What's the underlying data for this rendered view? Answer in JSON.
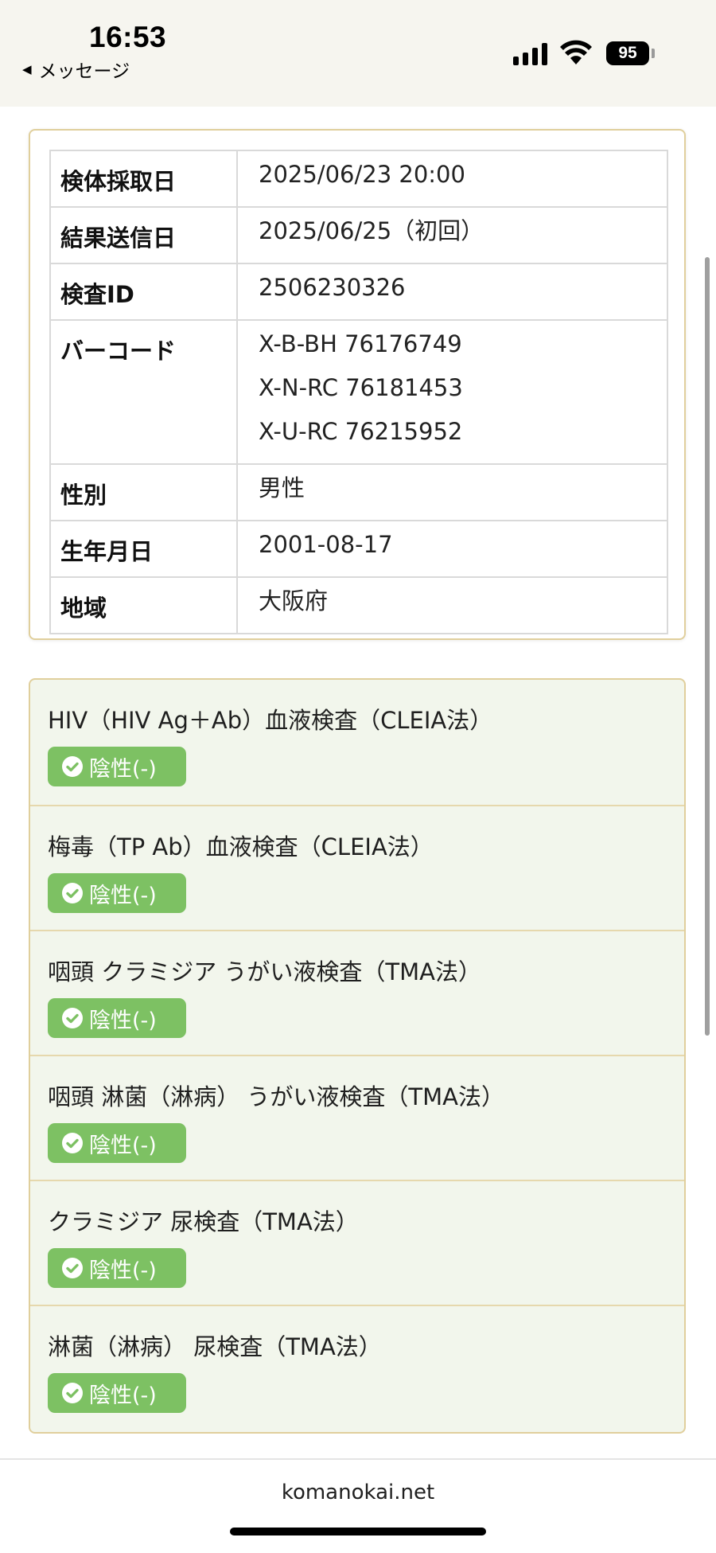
{
  "status_bar": {
    "time": "16:53",
    "back_label": "メッセージ",
    "battery": "95"
  },
  "info": {
    "rows": [
      {
        "label": "検体採取日",
        "values": [
          "2025/06/23  20:00"
        ]
      },
      {
        "label": "結果送信日",
        "values": [
          "2025/06/25（初回）"
        ]
      },
      {
        "label": "検査ID",
        "values": [
          "2506230326"
        ]
      },
      {
        "label": "バーコード",
        "values": [
          "X-B-BH  76176749",
          "X-N-RC  76181453",
          "X-U-RC  76215952"
        ]
      },
      {
        "label": "性別",
        "values": [
          "男性"
        ]
      },
      {
        "label": "生年月日",
        "values": [
          "2001-08-17"
        ]
      },
      {
        "label": "地域",
        "values": [
          "大阪府"
        ]
      }
    ]
  },
  "results": [
    {
      "title": "HIV（HIV Ag＋Ab）血液検査（CLEIA法）",
      "status": "陰性(-)"
    },
    {
      "title": "梅毒（TP Ab）血液検査（CLEIA法）",
      "status": "陰性(-)"
    },
    {
      "title": "咽頭 クラミジア うがい液検査（TMA法）",
      "status": "陰性(-)"
    },
    {
      "title": "咽頭 淋菌（淋病） うがい液検査（TMA法）",
      "status": "陰性(-)"
    },
    {
      "title": "クラミジア 尿検査（TMA法）",
      "status": "陰性(-)"
    },
    {
      "title": "淋菌（淋病） 尿検査（TMA法）",
      "status": "陰性(-)"
    }
  ],
  "footer": {
    "domain": "komanokai.net"
  },
  "colors": {
    "status_bar_bg": "#f6f5ef",
    "card_border": "#e0cf9c",
    "results_bg": "#f2f6ec",
    "negative_badge": "#7dc163"
  },
  "icons": {
    "badge_icon": "check-circle-icon",
    "back_icon": "back-triangle-icon",
    "signal_icon": "cellular-signal-icon",
    "wifi_icon": "wifi-icon",
    "battery_icon": "battery-icon"
  }
}
